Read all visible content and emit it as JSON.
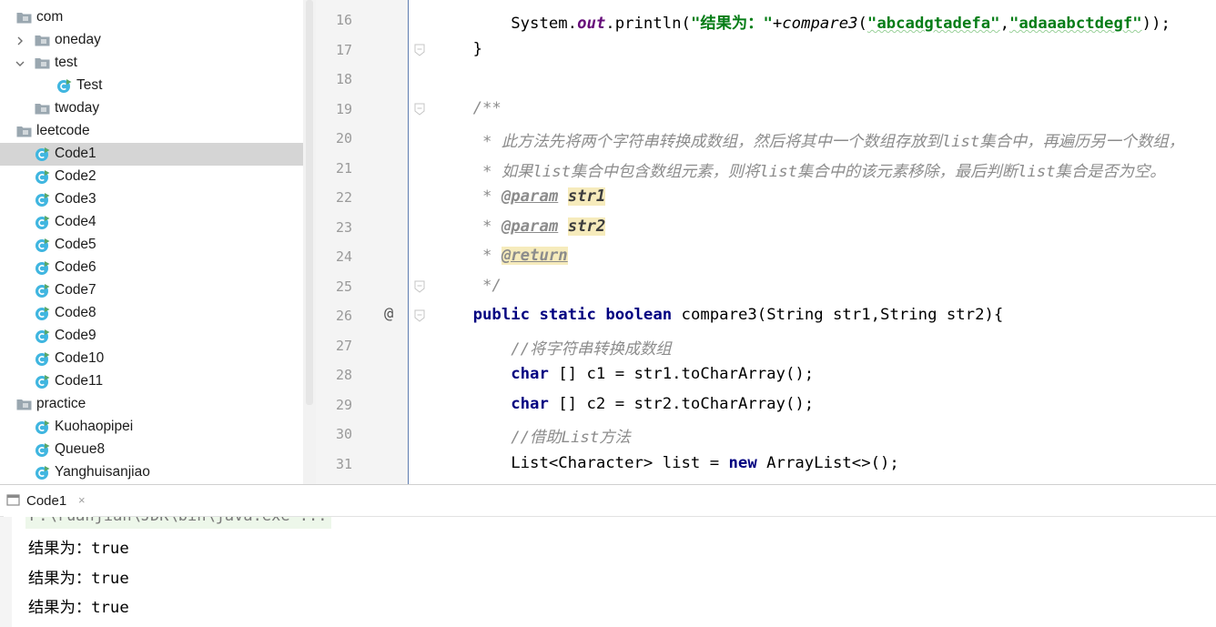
{
  "tree": {
    "items": [
      {
        "label": "com",
        "type": "folder",
        "depth": 0,
        "arrow": "none",
        "selected": false
      },
      {
        "label": "oneday",
        "type": "folder",
        "depth": 1,
        "arrow": "right",
        "selected": false
      },
      {
        "label": "test",
        "type": "folder",
        "depth": 1,
        "arrow": "down",
        "selected": false
      },
      {
        "label": "Test",
        "type": "class",
        "depth": 2,
        "arrow": "none",
        "selected": false
      },
      {
        "label": "twoday",
        "type": "folder",
        "depth": 1,
        "arrow": "none",
        "selected": false
      },
      {
        "label": "leetcode",
        "type": "folder",
        "depth": 0,
        "arrow": "none",
        "selected": false
      },
      {
        "label": "Code1",
        "type": "class",
        "depth": 1,
        "arrow": "none",
        "selected": true
      },
      {
        "label": "Code2",
        "type": "class",
        "depth": 1,
        "arrow": "none",
        "selected": false
      },
      {
        "label": "Code3",
        "type": "class",
        "depth": 1,
        "arrow": "none",
        "selected": false
      },
      {
        "label": "Code4",
        "type": "class",
        "depth": 1,
        "arrow": "none",
        "selected": false
      },
      {
        "label": "Code5",
        "type": "class",
        "depth": 1,
        "arrow": "none",
        "selected": false
      },
      {
        "label": "Code6",
        "type": "class",
        "depth": 1,
        "arrow": "none",
        "selected": false
      },
      {
        "label": "Code7",
        "type": "class",
        "depth": 1,
        "arrow": "none",
        "selected": false
      },
      {
        "label": "Code8",
        "type": "class",
        "depth": 1,
        "arrow": "none",
        "selected": false
      },
      {
        "label": "Code9",
        "type": "class",
        "depth": 1,
        "arrow": "none",
        "selected": false
      },
      {
        "label": "Code10",
        "type": "class",
        "depth": 1,
        "arrow": "none",
        "selected": false
      },
      {
        "label": "Code11",
        "type": "class",
        "depth": 1,
        "arrow": "none",
        "selected": false
      },
      {
        "label": "practice",
        "type": "folder",
        "depth": 0,
        "arrow": "none",
        "selected": false
      },
      {
        "label": "Kuohaopipei",
        "type": "class",
        "depth": 1,
        "arrow": "none",
        "selected": false
      },
      {
        "label": "Queue8",
        "type": "class",
        "depth": 1,
        "arrow": "none",
        "selected": false
      },
      {
        "label": "Yanghuisanjiao",
        "type": "class",
        "depth": 1,
        "arrow": "none",
        "selected": false
      }
    ]
  },
  "editor": {
    "lines": [
      {
        "num": "16",
        "marker": "",
        "fold": false,
        "tokens": [
          {
            "t": "        System.",
            "c": ""
          },
          {
            "t": "out",
            "c": "fld"
          },
          {
            "t": ".println(",
            "c": ""
          },
          {
            "t": "\"结果为：\"",
            "c": "str"
          },
          {
            "t": "+",
            "c": ""
          },
          {
            "t": "compare3",
            "c": "ital"
          },
          {
            "t": "(",
            "c": ""
          },
          {
            "t": "\"abcadgtadefa\"",
            "c": "str sq"
          },
          {
            "t": ",",
            "c": ""
          },
          {
            "t": "\"adaaabctdegf\"",
            "c": "str sq"
          },
          {
            "t": "));",
            "c": ""
          }
        ]
      },
      {
        "num": "17",
        "marker": "",
        "fold": true,
        "tokens": [
          {
            "t": "    }",
            "c": ""
          }
        ]
      },
      {
        "num": "18",
        "marker": "",
        "fold": false,
        "tokens": []
      },
      {
        "num": "19",
        "marker": "",
        "fold": true,
        "tokens": [
          {
            "t": "    /**",
            "c": "cmt"
          }
        ]
      },
      {
        "num": "20",
        "marker": "",
        "fold": false,
        "tokens": [
          {
            "t": "     * 此方法先将两个字符串转换成数组，然后将其中一个数组存放到list集合中，再遍历另一个数组，",
            "c": "cmt"
          }
        ]
      },
      {
        "num": "21",
        "marker": "",
        "fold": false,
        "tokens": [
          {
            "t": "     * 如果list集合中包含数组元素，则将list集合中的该元素移除，最后判断list集合是否为空。",
            "c": "cmt"
          }
        ]
      },
      {
        "num": "22",
        "marker": "",
        "fold": false,
        "tokens": [
          {
            "t": "     * ",
            "c": "cmt"
          },
          {
            "t": "@param",
            "c": "tag"
          },
          {
            "t": " ",
            "c": "cmt"
          },
          {
            "t": "str1",
            "c": "pname hl"
          }
        ]
      },
      {
        "num": "23",
        "marker": "",
        "fold": false,
        "tokens": [
          {
            "t": "     * ",
            "c": "cmt"
          },
          {
            "t": "@param",
            "c": "tag"
          },
          {
            "t": " ",
            "c": "cmt"
          },
          {
            "t": "str2",
            "c": "pname hl"
          }
        ]
      },
      {
        "num": "24",
        "marker": "",
        "fold": false,
        "tokens": [
          {
            "t": "     * ",
            "c": "cmt"
          },
          {
            "t": "@return",
            "c": "tag hl"
          }
        ]
      },
      {
        "num": "25",
        "marker": "",
        "fold": true,
        "tokens": [
          {
            "t": "     */",
            "c": "cmt"
          }
        ]
      },
      {
        "num": "26",
        "marker": "@",
        "fold": true,
        "tokens": [
          {
            "t": "    ",
            "c": ""
          },
          {
            "t": "public",
            "c": "kw"
          },
          {
            "t": " ",
            "c": ""
          },
          {
            "t": "static",
            "c": "kw"
          },
          {
            "t": " ",
            "c": ""
          },
          {
            "t": "boolean",
            "c": "kw"
          },
          {
            "t": " compare3(String str1,String str2){",
            "c": ""
          }
        ]
      },
      {
        "num": "27",
        "marker": "",
        "fold": false,
        "tokens": [
          {
            "t": "        //将字符串转换成数组",
            "c": "cmt"
          }
        ]
      },
      {
        "num": "28",
        "marker": "",
        "fold": false,
        "tokens": [
          {
            "t": "        ",
            "c": ""
          },
          {
            "t": "char",
            "c": "kw"
          },
          {
            "t": " [] c1 = str1.toCharArray();",
            "c": ""
          }
        ]
      },
      {
        "num": "29",
        "marker": "",
        "fold": false,
        "tokens": [
          {
            "t": "        ",
            "c": ""
          },
          {
            "t": "char",
            "c": "kw"
          },
          {
            "t": " [] c2 = str2.toCharArray();",
            "c": ""
          }
        ]
      },
      {
        "num": "30",
        "marker": "",
        "fold": false,
        "tokens": [
          {
            "t": "        //借助List方法",
            "c": "cmt"
          }
        ]
      },
      {
        "num": "31",
        "marker": "",
        "fold": false,
        "tokens": [
          {
            "t": "        List<Character> list = ",
            "c": ""
          },
          {
            "t": "new",
            "c": "kw"
          },
          {
            "t": " ArrayList<>();",
            "c": ""
          }
        ]
      }
    ]
  },
  "run": {
    "tab_label": "Code1",
    "close_glyph": "×",
    "command": "F:\\ruanjian\\JDK\\bin\\java.exe ...",
    "output": [
      "结果为：true",
      "结果为：true",
      "结果为：true"
    ]
  }
}
